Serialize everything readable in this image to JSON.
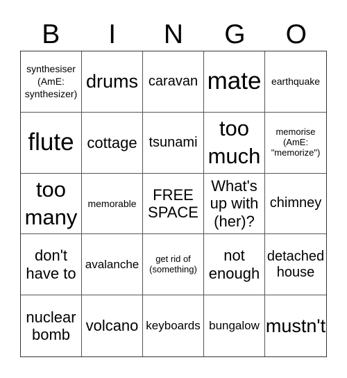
{
  "header": {
    "letters": [
      "B",
      "I",
      "N",
      "G",
      "O"
    ]
  },
  "cells": [
    "synthesiser (AmE: synthesizer)",
    "drums",
    "caravan",
    "mate",
    "earthquake",
    "flute",
    "cottage",
    "tsunami",
    "too much",
    "memorise (AmE: \"memorize\")",
    "too many",
    "memorable",
    "FREE SPACE",
    "What's up with (her)?",
    "chimney",
    "don't have to",
    "avalanche",
    "get rid of (something)",
    "not enough",
    "detached house",
    "nuclear bomb",
    "volcano",
    "keyboards",
    "bungalow",
    "mustn't"
  ]
}
